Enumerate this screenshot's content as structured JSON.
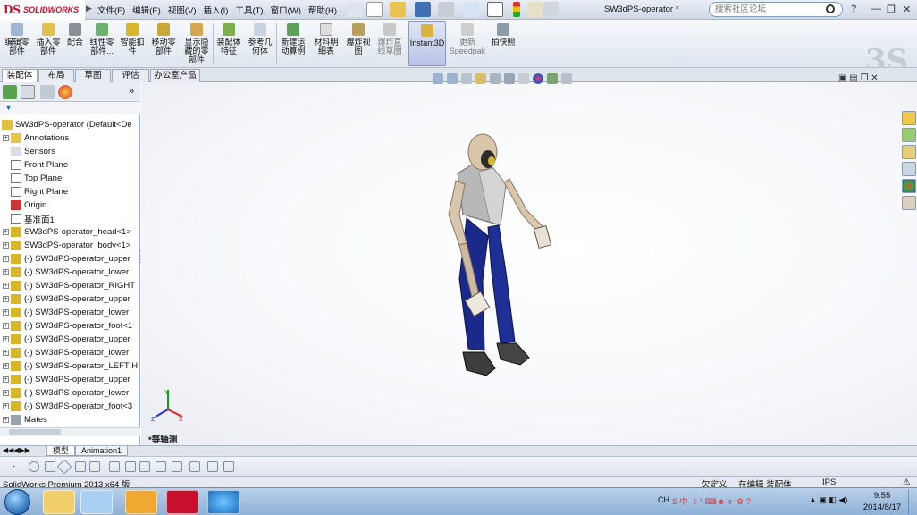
{
  "app": {
    "logo_text": "SOLIDWORKS",
    "logo_mark": "DS",
    "document_title": "SW3dPS-operator *",
    "menus": [
      "文件(F)",
      "编辑(E)",
      "视图(V)",
      "插入(I)",
      "工具(T)",
      "窗口(W)",
      "帮助(H)"
    ],
    "search_placeholder": "搜索社区论坛",
    "help_label": "?"
  },
  "toolbar": {
    "buttons": [
      {
        "label1": "编辑零",
        "label2": "部件",
        "disabled": false,
        "icon": "edit-part-icon"
      },
      {
        "label1": "插入零",
        "label2": "部件",
        "disabled": false,
        "icon": "insert-part-icon"
      },
      {
        "label1": "配合",
        "label2": "",
        "disabled": false,
        "icon": "mate-icon"
      },
      {
        "label1": "线性零",
        "label2": "部件...",
        "disabled": false,
        "icon": "linear-pattern-icon"
      },
      {
        "label1": "智能扣",
        "label2": "件",
        "disabled": false,
        "icon": "smart-fastener-icon"
      },
      {
        "label1": "移动零",
        "label2": "部件",
        "disabled": false,
        "icon": "move-part-icon"
      },
      {
        "label1": "显示隐",
        "label2": "藏的零",
        "label3": "部件",
        "disabled": false,
        "icon": "show-hidden-icon"
      },
      {
        "label1": "装配体",
        "label2": "特征",
        "disabled": false,
        "icon": "assembly-feature-icon"
      },
      {
        "label1": "参考几",
        "label2": "何体",
        "disabled": false,
        "icon": "reference-geometry-icon"
      },
      {
        "label1": "新建运",
        "label2": "动算例",
        "disabled": false,
        "icon": "motion-study-icon"
      },
      {
        "label1": "材料明",
        "label2": "细表",
        "disabled": false,
        "icon": "bom-icon"
      },
      {
        "label1": "爆炸视",
        "label2": "图",
        "disabled": false,
        "icon": "exploded-view-icon"
      },
      {
        "label1": "爆炸直",
        "label2": "线草图",
        "disabled": true,
        "icon": "explode-line-icon"
      },
      {
        "label1": "Instant3D",
        "label2": "",
        "disabled": false,
        "icon": "instant3d-icon"
      },
      {
        "label1": "更新",
        "label2": "Speedpak",
        "disabled": true,
        "icon": "speedpak-icon"
      },
      {
        "label1": "拍快照",
        "label2": "",
        "disabled": false,
        "icon": "snapshot-icon"
      }
    ]
  },
  "cm_tabs": [
    "装配体",
    "布局",
    "草图",
    "评估",
    "办公室产品"
  ],
  "tree": {
    "root": "SW3dPS-operator  (Default<De",
    "items": [
      {
        "label": "Annotations",
        "expand": true,
        "icon": "annotations-icon"
      },
      {
        "label": "Sensors",
        "expand": false,
        "icon": "sensors-icon"
      },
      {
        "label": "Front Plane",
        "expand": false,
        "icon": "plane-icon"
      },
      {
        "label": "Top Plane",
        "expand": false,
        "icon": "plane-icon"
      },
      {
        "label": "Right Plane",
        "expand": false,
        "icon": "plane-icon"
      },
      {
        "label": "Origin",
        "expand": false,
        "icon": "origin-icon"
      },
      {
        "label": "基准面1",
        "expand": false,
        "icon": "plane-icon"
      },
      {
        "label": "SW3dPS-operator_head<1>",
        "expand": true,
        "icon": "part-icon"
      },
      {
        "label": "SW3dPS-operator_body<1>",
        "expand": true,
        "icon": "part-icon"
      },
      {
        "label": "(-) SW3dPS-operator_upper",
        "expand": true,
        "icon": "part-icon"
      },
      {
        "label": "(-) SW3dPS-operator_lower",
        "expand": true,
        "icon": "part-icon"
      },
      {
        "label": "(-) SW3dPS-operator_RIGHT",
        "expand": true,
        "icon": "part-icon"
      },
      {
        "label": "(-) SW3dPS-operator_upper",
        "expand": true,
        "icon": "part-icon"
      },
      {
        "label": "(-) SW3dPS-operator_lower",
        "expand": true,
        "icon": "part-icon"
      },
      {
        "label": "(-) SW3dPS-operator_foot<1",
        "expand": true,
        "icon": "part-icon"
      },
      {
        "label": "(-) SW3dPS-operator_upper",
        "expand": true,
        "icon": "part-icon"
      },
      {
        "label": "(-) SW3dPS-operator_lower",
        "expand": true,
        "icon": "part-icon"
      },
      {
        "label": "(-) SW3dPS-operator_LEFT H",
        "expand": true,
        "icon": "part-icon"
      },
      {
        "label": "(-) SW3dPS-operator_upper",
        "expand": true,
        "icon": "part-icon"
      },
      {
        "label": "(-) SW3dPS-operator_lower",
        "expand": true,
        "icon": "part-icon"
      },
      {
        "label": "(-) SW3dPS-operator_foot<3",
        "expand": true,
        "icon": "part-icon"
      },
      {
        "label": "Mates",
        "expand": true,
        "icon": "mates-icon"
      }
    ]
  },
  "view": {
    "label": "*等轴测",
    "triad": {
      "x": "X",
      "y": "Y",
      "z": "Z"
    }
  },
  "bottom_tabs": [
    "模型",
    "Animation1"
  ],
  "status": {
    "product": "SolidWorks Premium 2013 x64 版",
    "state1": "欠定义",
    "state2": "在编辑 装配体",
    "units": "IPS"
  },
  "taskbar": {
    "tray_lang": "CH",
    "time": "9:55",
    "date": "2014/8/17"
  },
  "colors": {
    "brand_red": "#c8102e",
    "selected_tab": "#b9c4e8",
    "part_yellow": "#d8b62c"
  }
}
